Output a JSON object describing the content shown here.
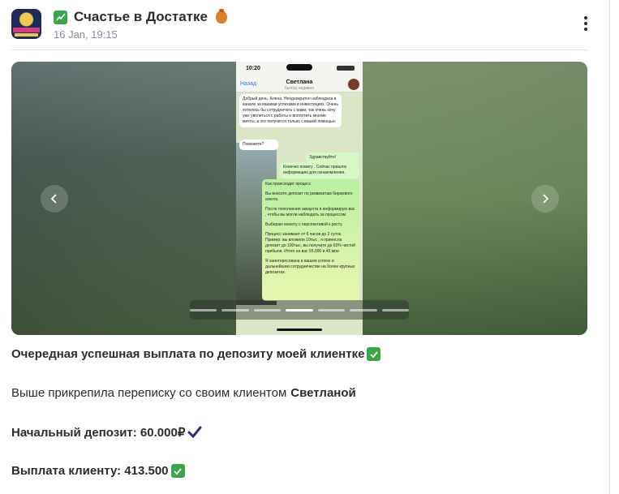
{
  "post": {
    "channel_title": "Счастье в Достатке",
    "date": "16 Jan, 19:15"
  },
  "gallery": {
    "slide_count": 7,
    "active_slide": 3,
    "screenshot": {
      "status_time": "10:20",
      "back_label": "Назад",
      "chat_name": "Светлана",
      "chat_status": "был(а) недавно",
      "messages": [
        "Добрый день, Алена. Неоднократно наблюдала в канале за вашими успехами в инвестициях. Очень хотелось бы сотрудничать с вами, так очень хочу уже уволиться с работы и воплотить многие мечты, а это получится только с вашей помощью",
        "Поможете?",
        "Здравствуйте!",
        "Конечно помогу . Сейчас пришлю информацию для ознакомления.",
        "Как происходит процесс",
        "Вы вносите депозит по реквизитам биржевого агента.",
        "После пополнения аккаунта я информирую вас , чтобы вы могли наблюдать за процессом.",
        "Выбираю монету с перспективой к росту.",
        "Процесс занимает от 6 часов до 2 суток. Пример: вы вложили 10тыс , я принесла депозит до 100тыс, вы получите до 60% чистой прибыли. Итого на вас 55.000 и 45 мои",
        "Я заинтересована в вашем успехе и дальнейшем сотрудничестве на более крупных депозитах."
      ]
    }
  },
  "body": {
    "line1": "Очередная успешная выплата по депозиту моей клиентке",
    "line2_prefix": "Выше прикрепила переписку со своим клиентом",
    "line2_name": "Светланой",
    "line3": "Начальный депозит: 60.000₽",
    "line4": "Выплата клиенту: 413.500"
  },
  "colors": {
    "accent_check": "#3aa64a",
    "heavy_check": "#3b2a8c"
  },
  "icons": {
    "menu": "more-vertical-icon",
    "prev": "chevron-left-icon",
    "next": "chevron-right-icon"
  }
}
